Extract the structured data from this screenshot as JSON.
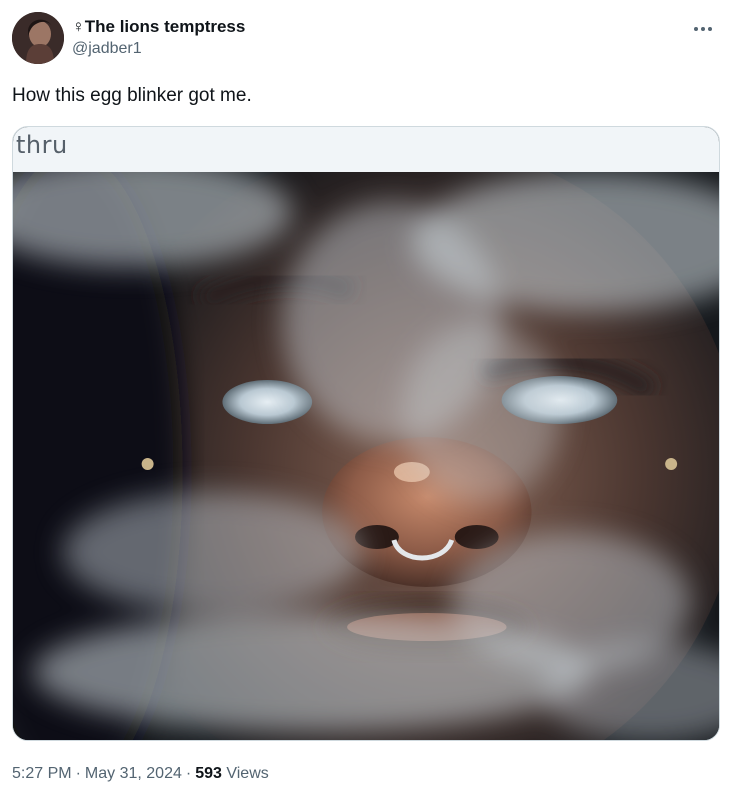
{
  "author": {
    "display_name": "♀The lions temptress",
    "handle": "@jadber1"
  },
  "tweet": {
    "text": "How this egg blinker got me."
  },
  "media": {
    "caption": "thru"
  },
  "meta": {
    "time": "5:27 PM",
    "separator": "·",
    "date": "May 31, 2024",
    "views_count": "593",
    "views_label": "Views"
  },
  "icons": {
    "more": "more-horizontal-icon"
  }
}
